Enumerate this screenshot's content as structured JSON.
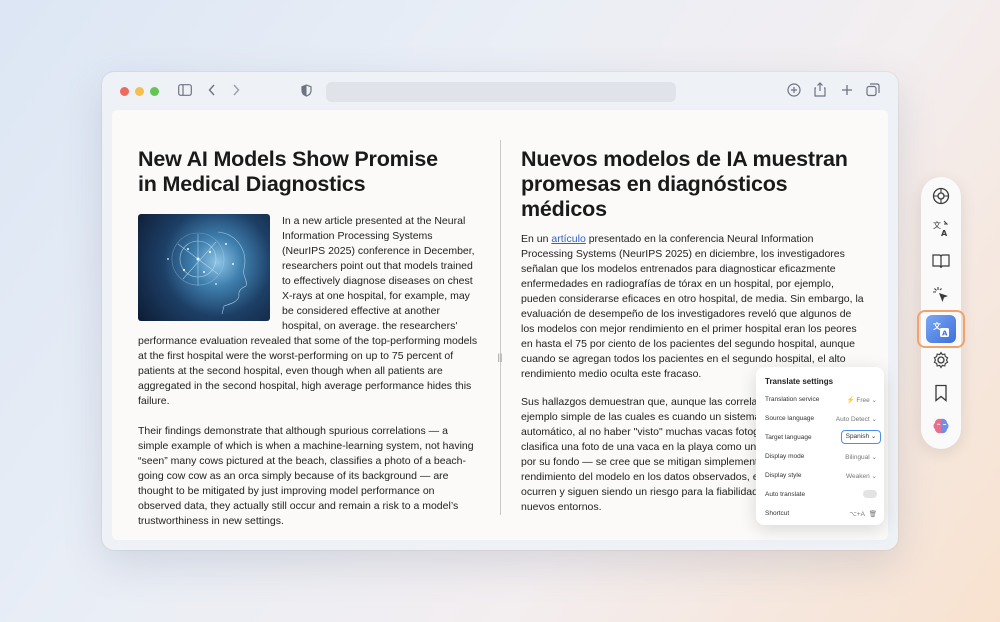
{
  "article_en": {
    "title_line1": "New AI Models Show Promise",
    "title_line2": "in Medical Diagnostics",
    "p1": "In a new article presented at the Neural Information Processing Systems (NeurIPS 2025) conference in December, researchers point out that models trained to effectively diagnose diseases on chest X-rays at one hospital, for example, may be considered effective at another hospital, on average. the researchers' performance evaluation revealed that some of the top-performing models at the first hospital were the worst-performing on up to 75 percent of patients at the second hospital, even though when all patients are aggregated in the second hospital, high average performance hides this failure.",
    "p2": "Their findings demonstrate that although spurious correlations — a simple example of which is when a machine-learning system, not having “seen” many cows pictured at the beach, classifies a photo of a beach-going cow cow as an orca simply because of its background — are thought to be mitigated by just improving model performance on observed data, they actually still occur and remain a risk to a model’s trustworthiness in new settings."
  },
  "article_es": {
    "title": "Nuevos modelos de IA muestran promesas en diagnósticos médicos",
    "p1_before": "En un ",
    "p1_link": "artículo",
    "p1_after": " presentado en la conferencia Neural Information Processing Systems (NeurIPS 2025) en diciembre, los investigadores señalan que los modelos entrenados para diagnosticar eficazmente enfermedades en radiografías de tórax en un hospital, por ejemplo, pueden considerarse eficaces en otro hospital, de media. Sin embargo, la evaluación de desempeño de los investigadores reveló que algunos de los modelos con mejor rendimiento en el primer hospital eran los peores en hasta el 75 por ciento de los pacientes del segundo hospital, aunque cuando se agregan todos los pacientes en el segundo hospital, el alto rendimiento medio oculta este fracaso.",
    "p2": "Sus hallazgos demuestran que, aunque las correlaciones espurias — un ejemplo simple de las cuales es cuando un sistema de aprendizaje automático, al no haber \"visto\" muchas vacas fotografiadas en la playa, clasifica una foto de una vaca en la playa como una orca simplemente por su fondo — se cree que se mitigan simplemente mejorando el rendimiento del modelo en los datos observados, en realidad todavía ocurren y siguen siendo un riesgo para la fiabilidad de un modelo en nuevos entornos."
  },
  "translate_panel": {
    "title": "Translate settings",
    "rows": [
      {
        "label": "Translation service",
        "value": "Free"
      },
      {
        "label": "Source language",
        "value": "Auto Detect"
      },
      {
        "label": "Target language",
        "value": "Spanish"
      },
      {
        "label": "Display mode",
        "value": "Bilingual"
      },
      {
        "label": "Display style",
        "value": "Weaken"
      },
      {
        "label": "Auto translate",
        "value": ""
      },
      {
        "label": "Shortcut",
        "value": "⌥+A"
      }
    ]
  },
  "colors": {
    "accent_orange": "#f2a26a",
    "accent_blue": "#4b8ef2",
    "link": "#2f62c7"
  },
  "icons": {
    "sidebar": [
      "chatbot-icon",
      "translate-icon",
      "reader-icon",
      "cursor-click-icon",
      "translate-active-icon",
      "gear-icon",
      "bookmark-icon",
      "brain-icon"
    ]
  }
}
